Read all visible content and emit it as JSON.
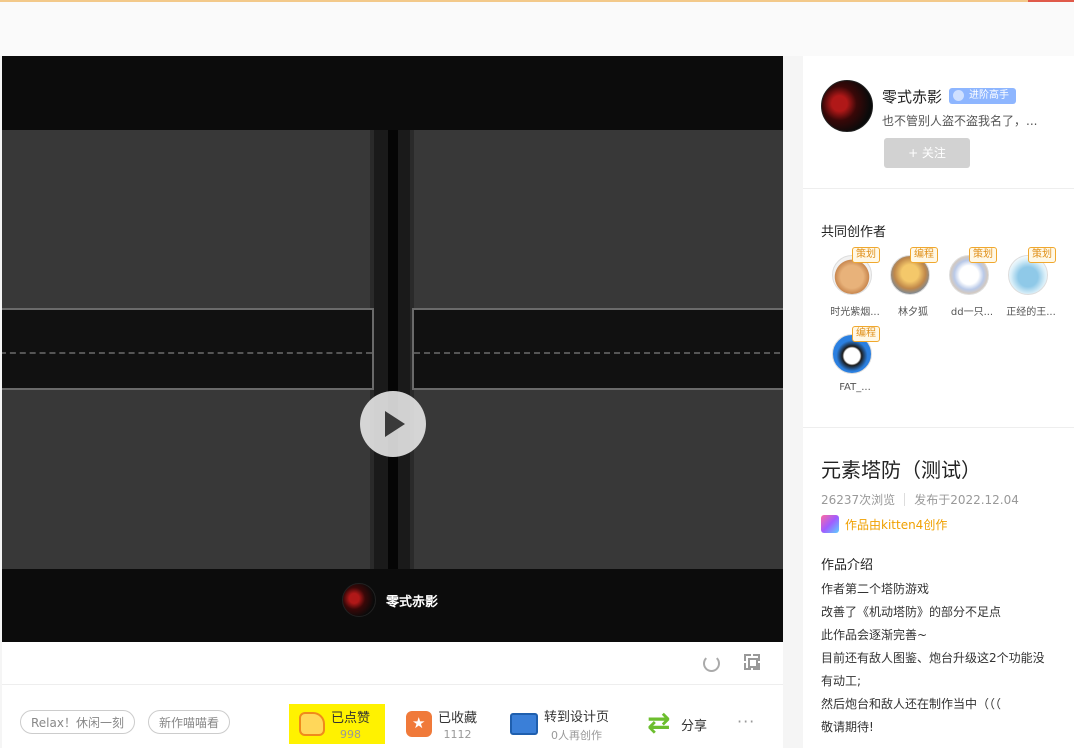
{
  "player": {
    "author_name": "零式赤影"
  },
  "actions": {
    "tags": [
      "Relax！休闲一刻",
      "新作喵喵看"
    ],
    "like": {
      "label": "已点赞",
      "count": "998"
    },
    "collect": {
      "label": "已收藏",
      "count": "1112"
    },
    "design": {
      "label": "转到设计页",
      "sub": "0人再创作"
    },
    "share": {
      "label": "分享"
    },
    "more": "···"
  },
  "author": {
    "name": "零式赤影",
    "badge": "进阶高手",
    "bio": "也不管别人盗不盗我名了，...",
    "follow_label": "+ 关注"
  },
  "coauthors": {
    "title": "共同创作者",
    "items": [
      {
        "role": "策划",
        "name": "时光紫烟..."
      },
      {
        "role": "编程",
        "name": "林夕狐"
      },
      {
        "role": "策划",
        "name": "dd一只..."
      },
      {
        "role": "策划",
        "name": "正经的王..."
      },
      {
        "role": "编程",
        "name": "FAT_..."
      }
    ]
  },
  "work": {
    "title": "元素塔防（测试）",
    "views": "26237次浏览",
    "published": "发布于2022.12.04",
    "made_with": "作品由kitten4创作",
    "desc_title": "作品介绍",
    "desc_lines": [
      "作者第二个塔防游戏",
      "改善了《机动塔防》的部分不足点",
      "此作品会逐渐完善~",
      "目前还有敌人图鉴、炮台升级这2个功能没",
      "有动工;",
      "然后炮台和敌人还在制作当中（（（",
      "敬请期待!"
    ]
  },
  "colors": {
    "accent_orange": "#f0a000",
    "like_highlight": "#fff200",
    "badge_blue": "#8eb6ff"
  }
}
